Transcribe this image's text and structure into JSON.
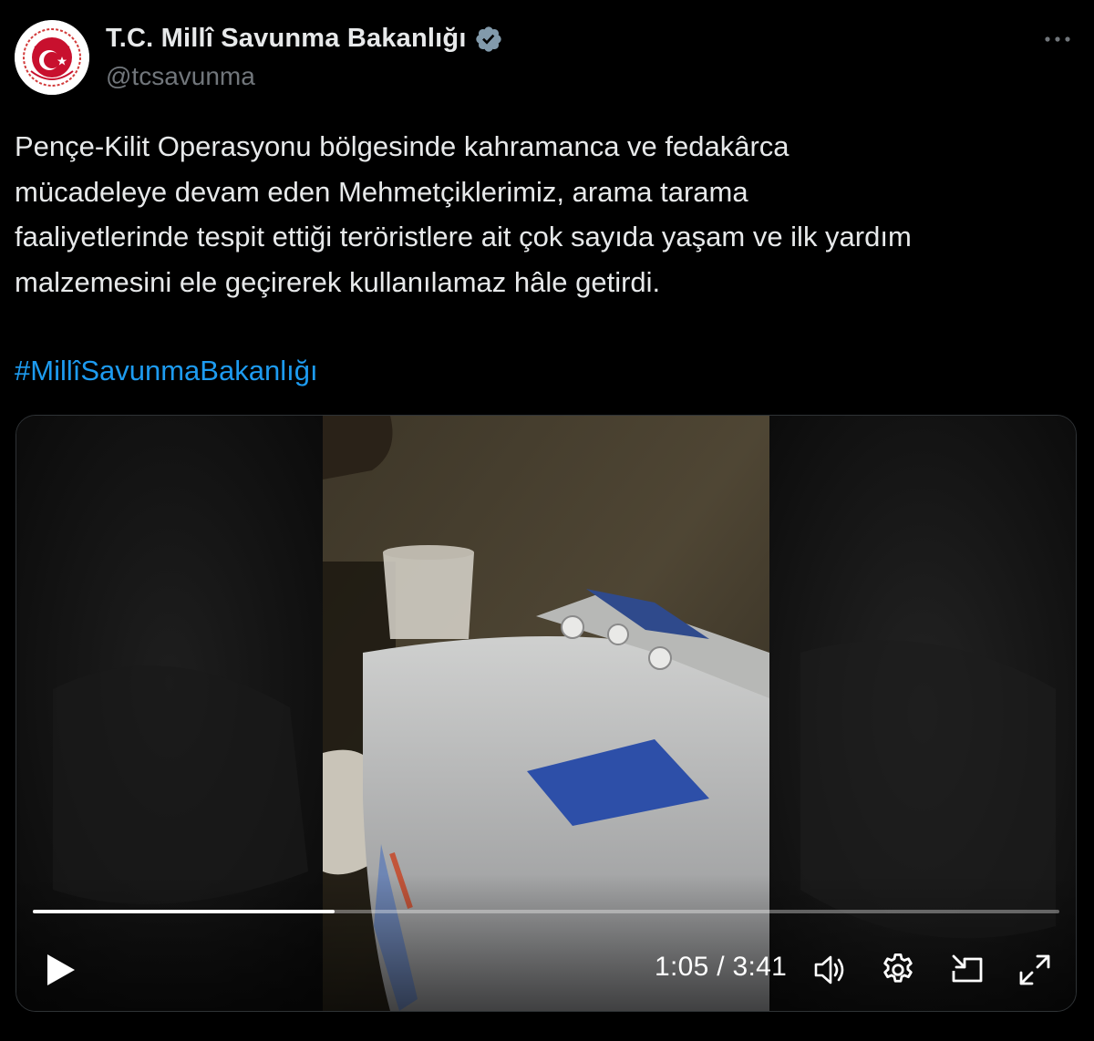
{
  "account": {
    "display_name": "T.C. Millî Savunma Bakanlığı",
    "handle": "@tcsavunma",
    "verified_icon": "verified-badge",
    "avatar_icon": "star-crescent-emblem"
  },
  "tweet": {
    "text_lines": [
      "Pençe-Kilit Operasyonu bölgesinde kahramanca ve fedakârca",
      "mücadeleye devam eden Mehmetçiklerimiz, arama tarama",
      "faaliyetlerinde tespit ettiği teröristlere ait çok sayıda yaşam ve ilk yardım",
      "malzemesini ele geçirerek kullanılamaz hâle getirdi."
    ],
    "hashtag": "#MillîSavunmaBakanlığı"
  },
  "video": {
    "current_time": "1:05",
    "duration": "3:41",
    "time_display": "1:05 / 3:41",
    "progress_fraction": 0.294,
    "icons": [
      "play-icon",
      "volume-icon",
      "settings-icon",
      "pip-icon",
      "fullscreen-icon"
    ]
  },
  "colors": {
    "background": "#000000",
    "text": "#e7e9ea",
    "secondary_text": "#71767b",
    "link": "#1d9bf0",
    "avatar_red": "#c8102e"
  }
}
